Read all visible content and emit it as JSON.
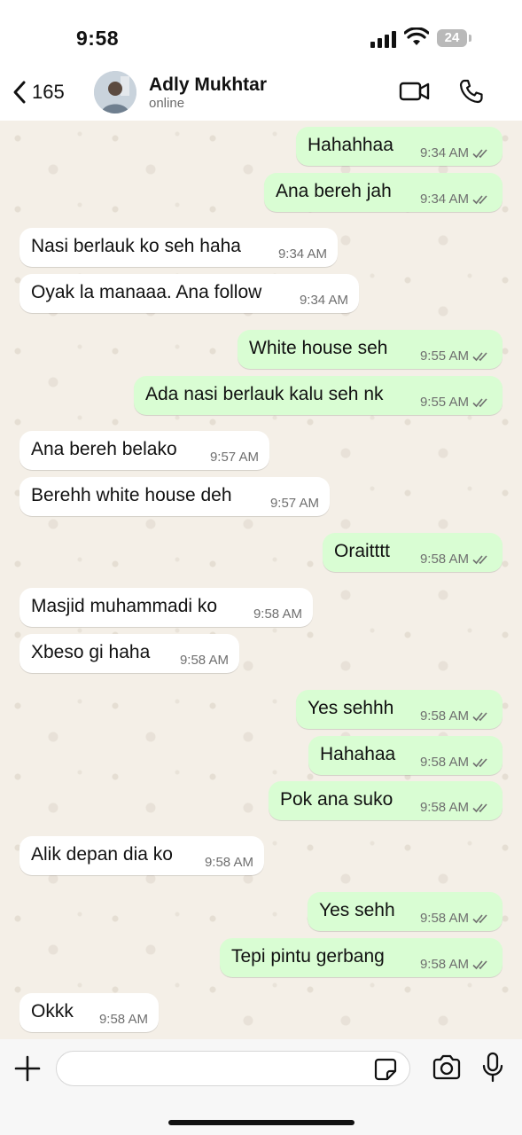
{
  "status_bar": {
    "time": "9:58",
    "battery": "24"
  },
  "header": {
    "back_count": "165",
    "contact_name": "Adly Mukhtar",
    "contact_status": "online"
  },
  "messages": [
    {
      "dir": "out",
      "text": "Hahahhaa",
      "time": "9:34 AM"
    },
    {
      "dir": "out",
      "text": "Ana bereh jah",
      "time": "9:34 AM"
    },
    {
      "dir": "in",
      "text": "Nasi berlauk ko seh haha",
      "time": "9:34 AM"
    },
    {
      "dir": "in",
      "text": "Oyak la manaaa. Ana follow",
      "time": "9:34 AM"
    },
    {
      "dir": "out",
      "text": "White house seh",
      "time": "9:55 AM"
    },
    {
      "dir": "out",
      "text": "Ada nasi berlauk kalu seh nk",
      "time": "9:55 AM"
    },
    {
      "dir": "in",
      "text": "Ana bereh belako",
      "time": "9:57 AM"
    },
    {
      "dir": "in",
      "text": "Berehh white house deh",
      "time": "9:57 AM"
    },
    {
      "dir": "out",
      "text": "Oraitttt",
      "time": "9:58 AM"
    },
    {
      "dir": "in",
      "text": "Masjid muhammadi ko",
      "time": "9:58 AM"
    },
    {
      "dir": "in",
      "text": "Xbeso gi haha",
      "time": "9:58 AM"
    },
    {
      "dir": "out",
      "text": "Yes sehhh",
      "time": "9:58 AM"
    },
    {
      "dir": "out",
      "text": "Hahahaa",
      "time": "9:58 AM"
    },
    {
      "dir": "out",
      "text": "Pok ana suko",
      "time": "9:58 AM"
    },
    {
      "dir": "in",
      "text": "Alik depan dia ko",
      "time": "9:58 AM"
    },
    {
      "dir": "out",
      "text": "Yes sehh",
      "time": "9:58 AM"
    },
    {
      "dir": "out",
      "text": "Tepi pintu gerbang",
      "time": "9:58 AM"
    },
    {
      "dir": "in",
      "text": "Okkk",
      "time": "9:58 AM"
    }
  ],
  "input": {
    "value": "",
    "placeholder": ""
  },
  "icons": {
    "back": "chevron-left-icon",
    "video": "video-camera-icon",
    "call": "phone-icon",
    "plus": "plus-icon",
    "sticker": "sticker-icon",
    "camera": "camera-icon",
    "mic": "microphone-icon",
    "read": "double-check-icon"
  },
  "colors": {
    "incoming_bubble": "#ffffff",
    "outgoing_bubble": "#d9fdd3",
    "chat_background": "#f4efe7",
    "read_ticks": "#6f6f6f"
  }
}
